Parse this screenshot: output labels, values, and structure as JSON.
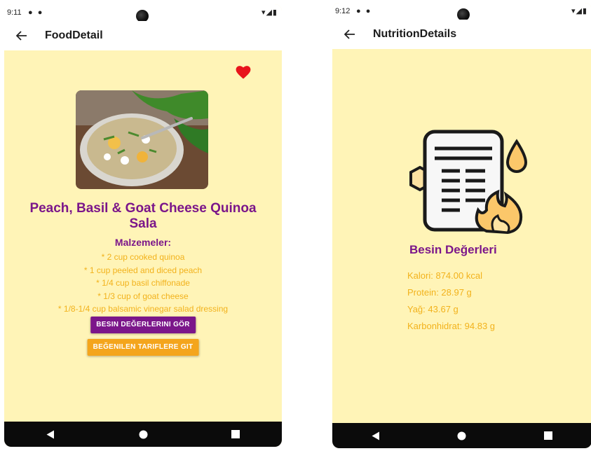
{
  "left_screen": {
    "status": {
      "time": "9:11"
    },
    "appbar": {
      "title": "FoodDetail"
    },
    "food": {
      "title": "Peach, Basil & Goat Cheese Quinoa Sala",
      "ingredients_heading": "Malzemeler:",
      "ingredients": [
        "* 2 cup cooked quinoa",
        "* 1 cup peeled and diced peach",
        "* 1/4 cup basil chiffonade",
        "* 1/3 cup of goat cheese",
        "* 1/8-1/4 cup balsamic vinegar salad dressing"
      ]
    },
    "buttons": {
      "nutrition": "BESIN DEĞERLERINI GÖR",
      "favorites": "BEĞENILEN TARIFLERE GIT"
    }
  },
  "right_screen": {
    "status": {
      "time": "9:12"
    },
    "appbar": {
      "title": "NutritionDetails"
    },
    "heading": "Besin Değerleri",
    "items": [
      "Kalori: 874.00 kcal",
      "Protein: 28.97 g",
      "Yağ: 43.67 g",
      "Karbonhidrat: 94.83 g"
    ]
  },
  "colors": {
    "background": "#fff4b7",
    "accent_purple": "#7b168a",
    "accent_orange": "#f4a51c",
    "text_yellow": "#f2b21c",
    "heart": "#e8141c"
  },
  "icons": [
    "back-arrow-icon",
    "heart-icon",
    "nav-back-icon",
    "nav-home-icon",
    "nav-recents-icon",
    "nutrition-document-icon"
  ]
}
